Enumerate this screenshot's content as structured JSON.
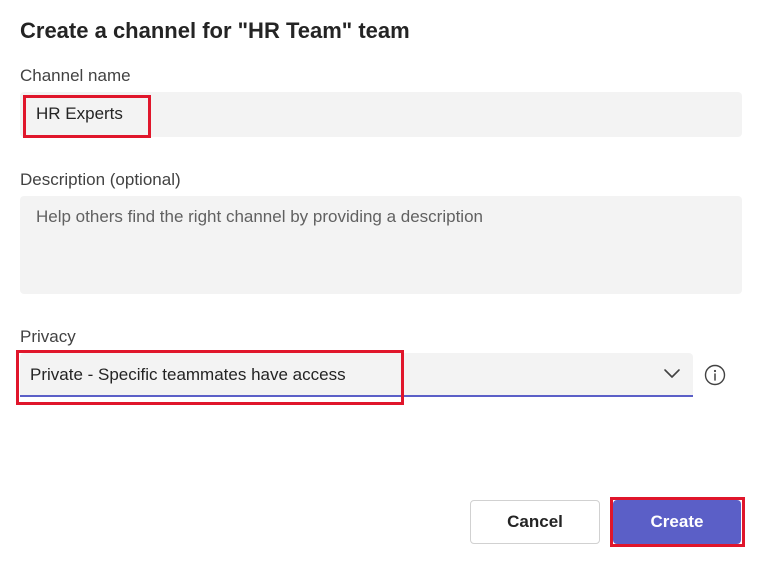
{
  "dialog": {
    "title": "Create a channel for \"HR Team\" team"
  },
  "channel_name": {
    "label": "Channel name",
    "value": "HR Experts"
  },
  "description": {
    "label": "Description (optional)",
    "placeholder": "Help others find the right channel by providing a description"
  },
  "privacy": {
    "label": "Privacy",
    "selected": "Private - Specific teammates have access",
    "dropdown_icon": "chevron-down-icon",
    "info_icon": "info-icon"
  },
  "actions": {
    "cancel_label": "Cancel",
    "create_label": "Create"
  },
  "colors": {
    "accent": "#5b5fc7",
    "field_background": "#f3f3f3",
    "highlight": "#e0162b"
  }
}
